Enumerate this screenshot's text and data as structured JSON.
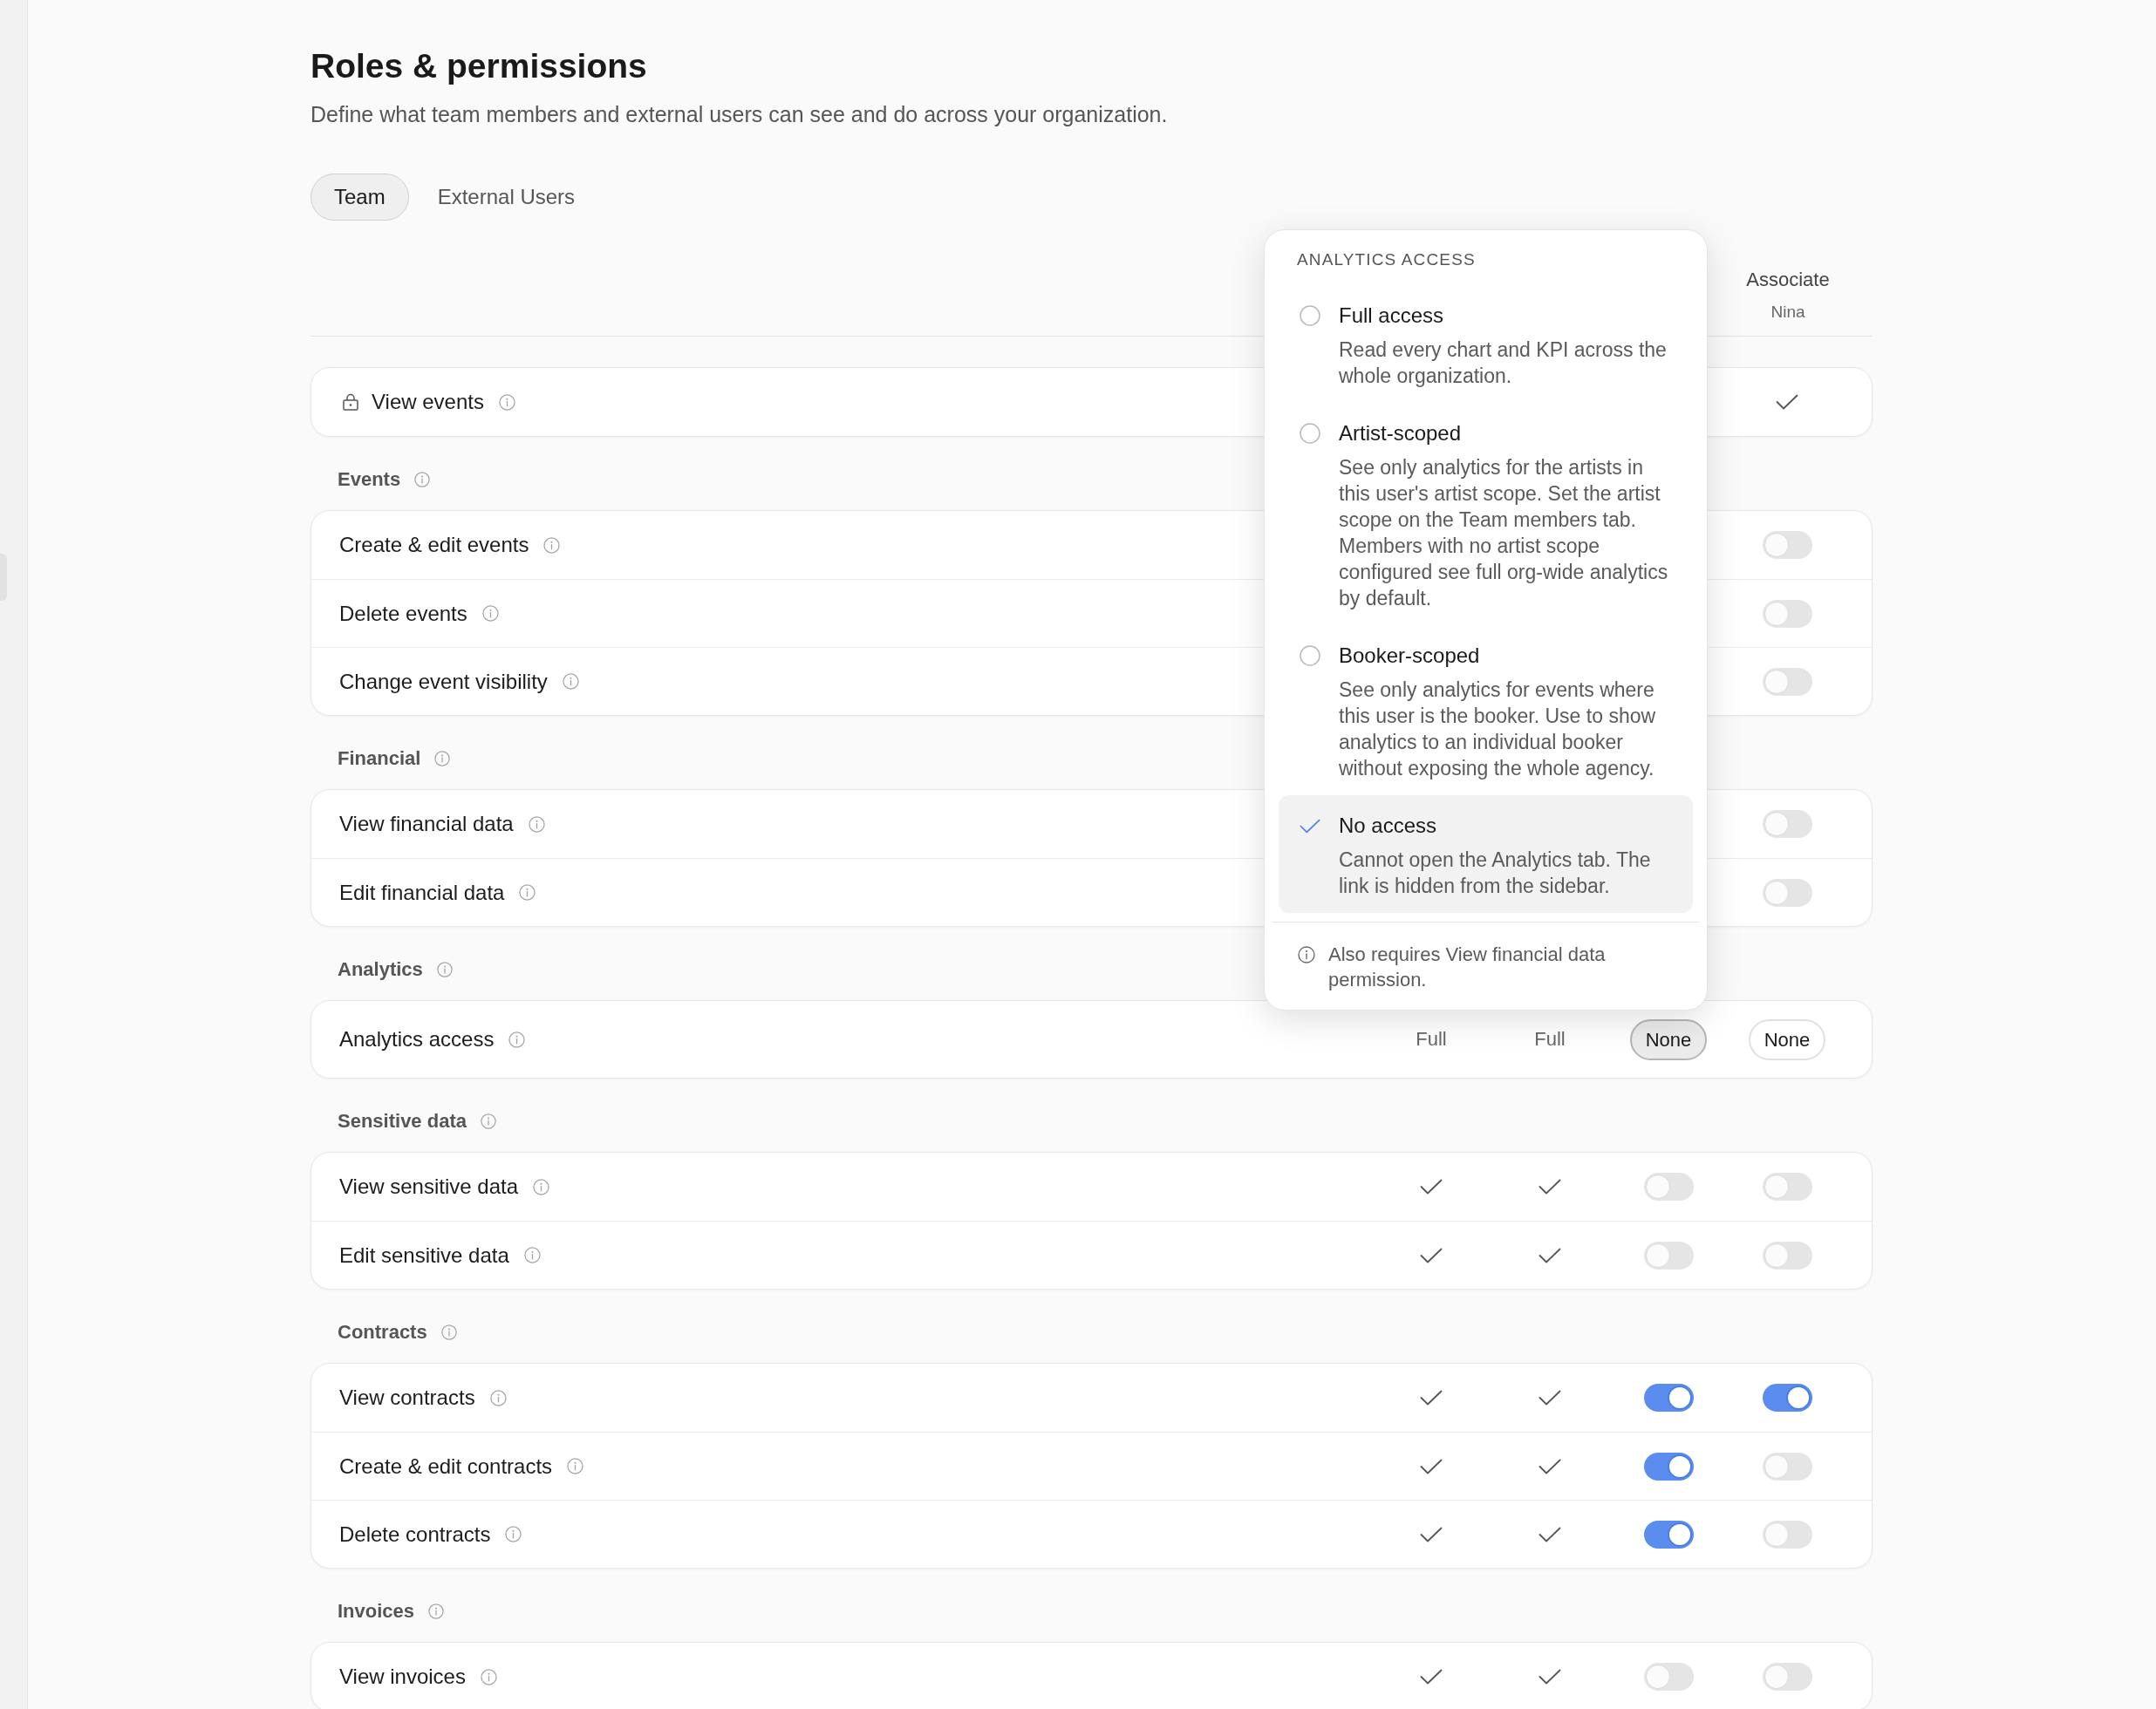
{
  "page": {
    "title": "Roles & permissions",
    "subtitle": "Define what team members and external users can see and do across your organization."
  },
  "tabs": [
    {
      "label": "Team",
      "selected": true
    },
    {
      "label": "External Users",
      "selected": false
    }
  ],
  "columns": [
    {
      "role": "Associate",
      "member": "Nina"
    }
  ],
  "sections": [
    {
      "rows": [
        {
          "label": "View events",
          "locked": true,
          "cells": [
            {
              "kind": "check"
            }
          ]
        }
      ]
    },
    {
      "title": "Events",
      "rows": [
        {
          "label": "Create & edit events",
          "locked": false,
          "cells": [
            {
              "kind": "toggle",
              "on": false
            }
          ]
        },
        {
          "label": "Delete events",
          "locked": false,
          "cells": [
            {
              "kind": "toggle",
              "on": false
            }
          ]
        },
        {
          "label": "Change event visibility",
          "locked": false,
          "cells": [
            {
              "kind": "toggle",
              "on": false
            }
          ]
        }
      ]
    },
    {
      "title": "Financial",
      "rows": [
        {
          "label": "View financial data",
          "locked": false,
          "cells": [
            {
              "kind": "toggle",
              "on": false
            }
          ]
        },
        {
          "label": "Edit financial data",
          "locked": false,
          "cells": [
            {
              "kind": "toggle",
              "on": false
            }
          ]
        }
      ]
    },
    {
      "title": "Analytics",
      "rows": [
        {
          "label": "Analytics access",
          "locked": false,
          "cells": [
            {
              "kind": "text",
              "value": "Full"
            },
            {
              "kind": "text",
              "value": "Full"
            },
            {
              "kind": "select",
              "value": "None",
              "open": true
            },
            {
              "kind": "select",
              "value": "None",
              "open": false
            }
          ]
        }
      ]
    },
    {
      "title": "Sensitive data",
      "rows": [
        {
          "label": "View sensitive data",
          "locked": false,
          "cells": [
            {
              "kind": "check"
            },
            {
              "kind": "check"
            },
            {
              "kind": "toggle",
              "on": false
            },
            {
              "kind": "toggle",
              "on": false
            }
          ]
        },
        {
          "label": "Edit sensitive data",
          "locked": false,
          "cells": [
            {
              "kind": "check"
            },
            {
              "kind": "check"
            },
            {
              "kind": "toggle",
              "on": false
            },
            {
              "kind": "toggle",
              "on": false
            }
          ]
        }
      ]
    },
    {
      "title": "Contracts",
      "rows": [
        {
          "label": "View contracts",
          "locked": false,
          "cells": [
            {
              "kind": "check"
            },
            {
              "kind": "check"
            },
            {
              "kind": "toggle",
              "on": true
            },
            {
              "kind": "toggle",
              "on": true
            }
          ]
        },
        {
          "label": "Create & edit contracts",
          "locked": false,
          "cells": [
            {
              "kind": "check"
            },
            {
              "kind": "check"
            },
            {
              "kind": "toggle",
              "on": true
            },
            {
              "kind": "toggle",
              "on": false
            }
          ]
        },
        {
          "label": "Delete contracts",
          "locked": false,
          "cells": [
            {
              "kind": "check"
            },
            {
              "kind": "check"
            },
            {
              "kind": "toggle",
              "on": true
            },
            {
              "kind": "toggle",
              "on": false
            }
          ]
        }
      ]
    },
    {
      "title": "Invoices",
      "rows": [
        {
          "label": "View invoices",
          "locked": false,
          "cells": [
            {
              "kind": "check"
            },
            {
              "kind": "check"
            },
            {
              "kind": "toggle",
              "on": false
            },
            {
              "kind": "toggle",
              "on": false
            }
          ]
        }
      ]
    }
  ],
  "popup": {
    "title": "ANALYTICS ACCESS",
    "options": [
      {
        "label": "Full access",
        "description": "Read every chart and KPI across the whole organization.",
        "selected": false
      },
      {
        "label": "Artist-scoped",
        "description": "See only analytics for the artists in this user's artist scope. Set the artist scope on the Team members tab. Members with no artist scope configured see full org-wide analytics by default.",
        "selected": false
      },
      {
        "label": "Booker-scoped",
        "description": "See only analytics for events where this user is the booker. Use to show analytics to an individual booker without exposing the whole agency.",
        "selected": false
      },
      {
        "label": "No access",
        "description": "Cannot open the Analytics tab. The link is hidden from the sidebar.",
        "selected": true
      }
    ],
    "note": "Also requires View financial data permission."
  }
}
